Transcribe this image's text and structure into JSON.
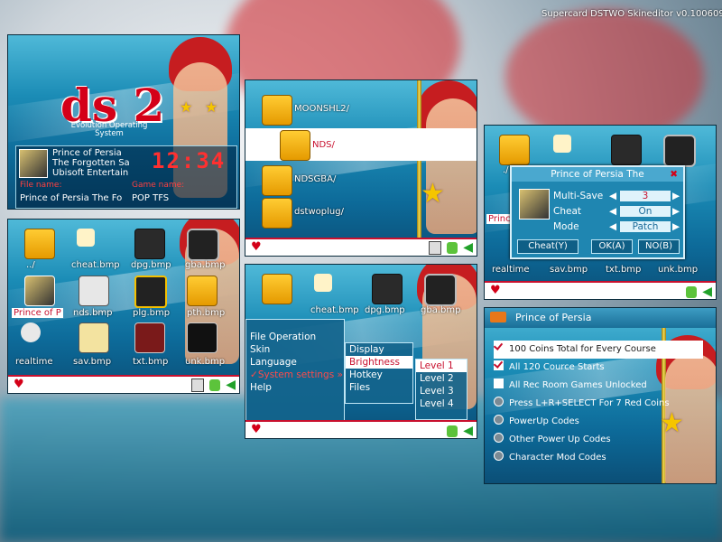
{
  "title": "Supercard DSTWO Skineditor v0.100609",
  "p1": {
    "logo": "ds 2",
    "subtitle": "Evolution Operating System",
    "game_line1": "Prince of Persia",
    "game_line2": "The Forgotten Sa",
    "game_line3": "Ubisoft Entertain",
    "clock": "12:34",
    "file_name_label": "File name:",
    "game_name_label": "Game name:",
    "file_name": "Prince of Persia The Fo",
    "game_name": "POP TFS"
  },
  "p2": {
    "icons": [
      {
        "label": "../"
      },
      {
        "label": "cheat.bmp"
      },
      {
        "label": "dpg.bmp"
      },
      {
        "label": "gba.bmp"
      },
      {
        "label": "Prince of P"
      },
      {
        "label": "nds.bmp"
      },
      {
        "label": "plg.bmp"
      },
      {
        "label": "pth.bmp"
      },
      {
        "label": "realtime"
      },
      {
        "label": "sav.bmp"
      },
      {
        "label": "txt.bmp"
      },
      {
        "label": "unk.bmp"
      }
    ]
  },
  "p3": {
    "rows": [
      "MOONSHL2/",
      "NDS/",
      "NDSGBA/",
      "dstwoplug/"
    ]
  },
  "p4": {
    "top_icons": [
      "cheat.bmp",
      "dpg.bmp",
      "gba.bmp"
    ],
    "menu1": [
      "File Operation",
      "Skin",
      "Language",
      "System settings",
      "Help"
    ],
    "menu2": [
      "Display",
      "Brightness",
      "Hotkey",
      "Files"
    ],
    "menu3": [
      "Level 1",
      "Level 2",
      "Level 3",
      "Level 4"
    ]
  },
  "p5": {
    "dialog_title": "Prince of Persia The",
    "fields": [
      {
        "label": "Multi-Save",
        "value": "3"
      },
      {
        "label": "Cheat",
        "value": "On"
      },
      {
        "label": "Mode",
        "value": "Patch"
      }
    ],
    "btn_cheat": "Cheat(Y)",
    "btn_ok": "OK(A)",
    "btn_no": "NO(B)",
    "back_label": "./",
    "bottom_labels": [
      "realtime",
      "sav.bmp",
      "txt.bmp",
      "unk.bmp"
    ],
    "side_label": "Prince of P"
  },
  "p6": {
    "title": "Prince of Persia",
    "items": [
      {
        "label": "100 Coins Total for Every Course",
        "kind": "check",
        "on": true
      },
      {
        "label": "All 120 Cource Starts",
        "kind": "check",
        "on": true
      },
      {
        "label": "All Rec Room Games Unlocked",
        "kind": "check",
        "on": false
      },
      {
        "label": "Press L+R+SELECT For 7 Red Coins",
        "kind": "radio",
        "on": false
      },
      {
        "label": "PowerUp Codes",
        "kind": "radio",
        "on": false
      },
      {
        "label": "Other Power Up Codes",
        "kind": "radio",
        "on": false
      },
      {
        "label": "Character Mod Codes",
        "kind": "radio",
        "on": false
      }
    ]
  }
}
